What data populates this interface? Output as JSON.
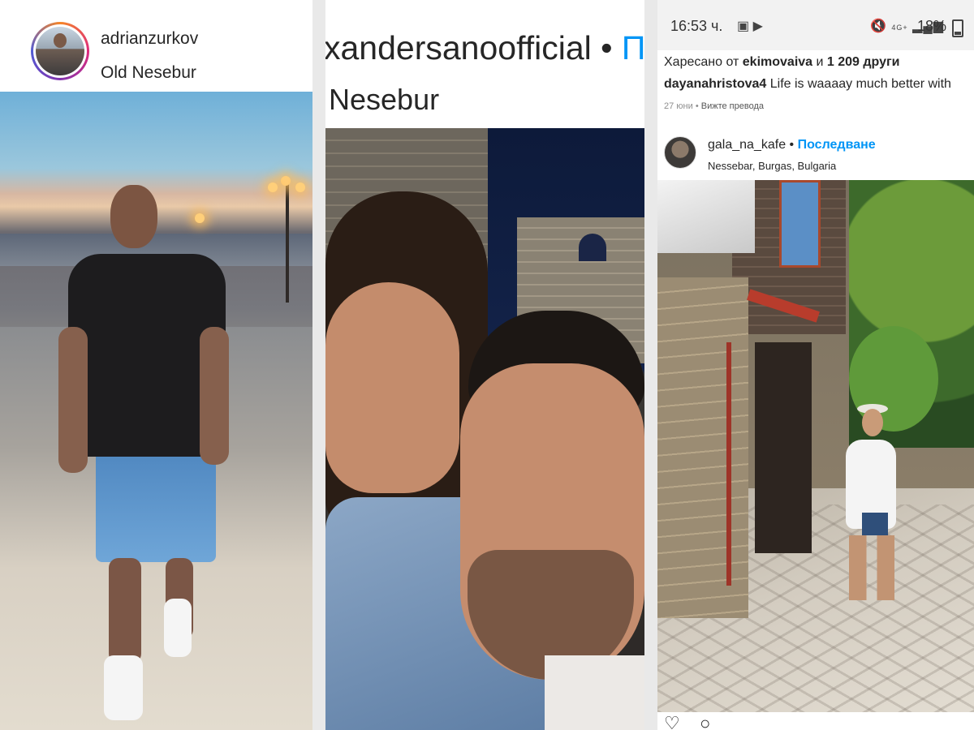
{
  "panel1": {
    "username": "adrianzurkov",
    "location": "Old Nesebur"
  },
  "panel2": {
    "username": "xandersanoofficial",
    "separator": "•",
    "follow": "П",
    "location": "Nesebur"
  },
  "panel3": {
    "status_bar": {
      "time": "16:53 ч.",
      "network": "4G+",
      "battery": "18%"
    },
    "likes": {
      "prefix": "Харесано от",
      "user": "ekimovaiva",
      "conj": "и",
      "others": "1 209 други"
    },
    "caption": {
      "user": "dayanahristova4",
      "text": "Life is waaaay much better with"
    },
    "meta": {
      "date": "27 юни",
      "separator": "•",
      "translate": "Вижте превода"
    },
    "post": {
      "username": "gala_na_kafe",
      "separator": "•",
      "follow": "Последване",
      "location": "Nessebar, Burgas, Bulgaria"
    },
    "icons": [
      "image-icon",
      "youtube-icon",
      "mute-icon",
      "signal-icon",
      "battery-icon",
      "heart-icon",
      "comment-icon"
    ]
  }
}
